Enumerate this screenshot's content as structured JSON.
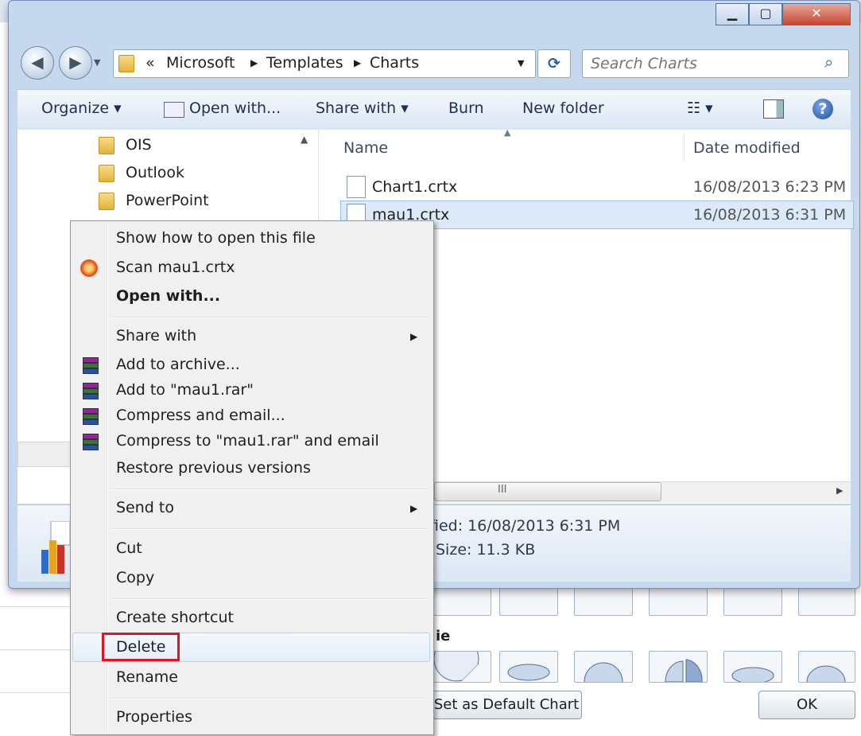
{
  "window": {
    "breadcrumb": [
      "«",
      "Microsoft",
      "Templates",
      "Charts"
    ],
    "search_placeholder": "Search Charts",
    "minimize": "▁",
    "maximize": "▢",
    "close": "✕"
  },
  "toolbar": {
    "organize": "Organize ▾",
    "open_with": "Open with...",
    "share_with": "Share with ▾",
    "burn": "Burn",
    "new_folder": "New folder",
    "views": "☷ ▾"
  },
  "nav_pane": {
    "folders": [
      "OIS",
      "Outlook",
      "PowerPoint"
    ]
  },
  "file_list": {
    "columns": [
      "Name",
      "Date modified"
    ],
    "rows": [
      {
        "name": "Chart1.crtx",
        "date": "16/08/2013 6:23 PM"
      },
      {
        "name": "mau1.crtx",
        "date": "16/08/2013 6:31 PM"
      }
    ],
    "scroll_grip": "III"
  },
  "details": {
    "modified": "fied: 16/08/2013 6:31 PM",
    "size": "Size: 11.3 KB"
  },
  "context_menu": {
    "show_how": "Show how to open this file",
    "scan": "Scan mau1.crtx",
    "open_with": "Open with...",
    "share_with": "Share with",
    "add_archive": "Add to archive...",
    "add_rar": "Add to \"mau1.rar\"",
    "compress_email": "Compress and email...",
    "compress_rar_email": "Compress to \"mau1.rar\" and email",
    "restore": "Restore previous versions",
    "send_to": "Send to",
    "cut": "Cut",
    "copy": "Copy",
    "create_shortcut": "Create shortcut",
    "delete": "Delete",
    "rename": "Rename",
    "properties": "Properties"
  },
  "dialog": {
    "pie_label": "ie",
    "set_default": "Set as Default Chart",
    "ok": "OK"
  }
}
